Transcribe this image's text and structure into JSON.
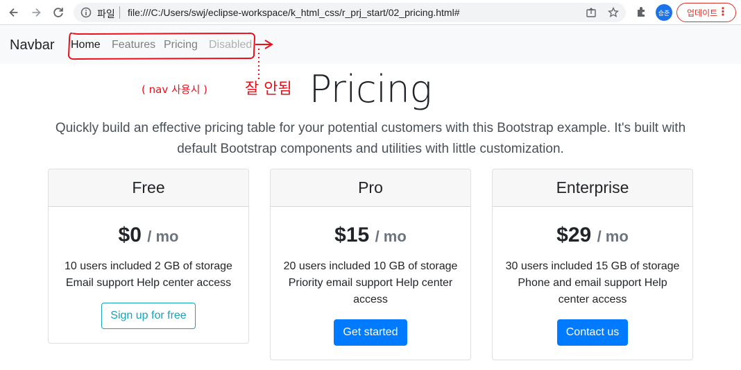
{
  "browser": {
    "scheme_label": "파일",
    "url": "file:///C:/Users/swj/eclipse-workspace/k_html_css/r_prj_start/02_pricing.html#",
    "avatar_text": "승준",
    "update_label": "업데이트",
    "menu_glyph": "⋮"
  },
  "navbar": {
    "brand": "Navbar",
    "links": [
      {
        "label": "Home",
        "state": "active"
      },
      {
        "label": "Features",
        "state": "normal"
      },
      {
        "label": "Pricing",
        "state": "normal"
      },
      {
        "label": "Disabled",
        "state": "disabled"
      }
    ]
  },
  "annotation": {
    "note_left": "( nav 사용시 )",
    "note_right": "잘 안됨",
    "color": "#e8101a"
  },
  "hero": {
    "title": "Pricing",
    "lead": "Quickly build an effective pricing table for your potential customers with this Bootstrap example. It's built with default Bootstrap components and utilities with little customization."
  },
  "plans": [
    {
      "name": "Free",
      "price": "$0",
      "per": "/ mo",
      "features": [
        "10 users included 2 GB of storage",
        "Email support Help center access"
      ],
      "button": "Sign up for free",
      "button_style": "outline"
    },
    {
      "name": "Pro",
      "price": "$15",
      "per": "/ mo",
      "features": [
        "20 users included 10 GB of storage",
        "Priority email support Help center access"
      ],
      "button": "Get started",
      "button_style": "primary"
    },
    {
      "name": "Enterprise",
      "price": "$29",
      "per": "/ mo",
      "features": [
        "30 users included 15 GB of storage",
        "Phone and email support Help center access"
      ],
      "button": "Contact us",
      "button_style": "primary"
    }
  ],
  "colors": {
    "primary": "#007bff",
    "info": "#17a2b8",
    "navbar_bg": "#f8f9fa"
  }
}
